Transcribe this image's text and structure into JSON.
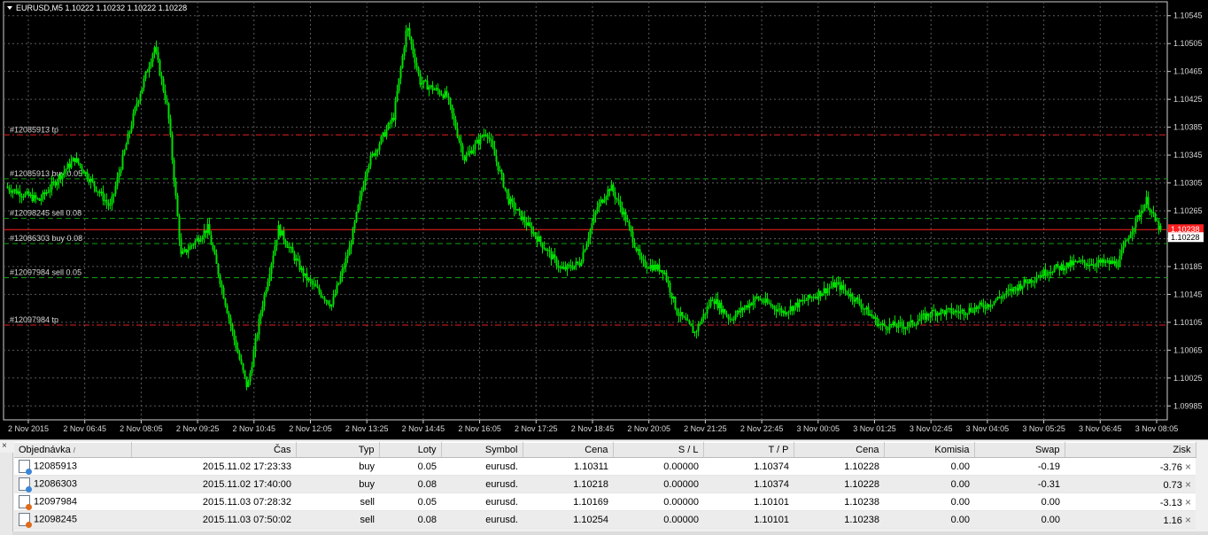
{
  "chart": {
    "header": "EURUSD,M5  1.10222 1.10232 1.10222 1.10228",
    "y_ticks": [
      "1.10545",
      "1.10505",
      "1.10465",
      "1.10425",
      "1.10385",
      "1.10345",
      "1.10305",
      "1.10265",
      "1.10225",
      "1.10185",
      "1.10145",
      "1.10105",
      "1.10065",
      "1.10025",
      "1.09985"
    ],
    "x_ticks": [
      "2 Nov 2015",
      "2 Nov 06:45",
      "2 Nov 08:05",
      "2 Nov 09:25",
      "2 Nov 10:45",
      "2 Nov 12:05",
      "2 Nov 13:25",
      "2 Nov 14:45",
      "2 Nov 16:05",
      "2 Nov 17:25",
      "2 Nov 18:45",
      "2 Nov 20:05",
      "2 Nov 21:25",
      "2 Nov 22:45",
      "3 Nov 00:05",
      "3 Nov 01:25",
      "3 Nov 02:45",
      "3 Nov 04:05",
      "3 Nov 05:25",
      "3 Nov 06:45",
      "3 Nov 08:05"
    ],
    "price_tag_bid": "1.10238",
    "price_tag_current": "1.10228",
    "colors": {
      "background": "#000000",
      "candle": "#00e000",
      "grid": "#5a5a5a",
      "tp": "#e02020",
      "sl": "#10a010",
      "bid": "#ff2020"
    },
    "levels": [
      {
        "label": "#12085913 tp",
        "price": 1.10374,
        "kind": "tp"
      },
      {
        "label": "#12085913 buy 0.05",
        "price": 1.10311,
        "kind": "entry"
      },
      {
        "label": "#12098245 sell 0.08",
        "price": 1.10254,
        "kind": "entry"
      },
      {
        "label": "#12086303 buy 0.08",
        "price": 1.10218,
        "kind": "entry"
      },
      {
        "label": "#12097984 sell 0.05",
        "price": 1.10169,
        "kind": "entry"
      },
      {
        "label": "#12097984 tp",
        "price": 1.10101,
        "kind": "tp"
      }
    ],
    "bid_price": 1.10238
  },
  "terminal": {
    "close_label": "×",
    "columns": [
      "Objednávka",
      "Čas",
      "Typ",
      "Loty",
      "Symbol",
      "Cena",
      "S / L",
      "T / P",
      "Cena",
      "Komisia",
      "Swap",
      "Zisk"
    ],
    "rows": [
      {
        "order": "12085913",
        "time": "2015.11.02 17:23:33",
        "type": "buy",
        "lots": "0.05",
        "symbol": "eurusd.",
        "price": "1.10311",
        "sl": "0.00000",
        "tp": "1.10374",
        "cur": "1.10228",
        "commission": "0.00",
        "swap": "-0.19",
        "profit": "-3.76"
      },
      {
        "order": "12086303",
        "time": "2015.11.02 17:40:00",
        "type": "buy",
        "lots": "0.08",
        "symbol": "eurusd.",
        "price": "1.10218",
        "sl": "0.00000",
        "tp": "1.10374",
        "cur": "1.10228",
        "commission": "0.00",
        "swap": "-0.31",
        "profit": "0.73"
      },
      {
        "order": "12097984",
        "time": "2015.11.03 07:28:32",
        "type": "sell",
        "lots": "0.05",
        "symbol": "eurusd.",
        "price": "1.10169",
        "sl": "0.00000",
        "tp": "1.10101",
        "cur": "1.10238",
        "commission": "0.00",
        "swap": "0.00",
        "profit": "-3.13"
      },
      {
        "order": "12098245",
        "time": "2015.11.03 07:50:02",
        "type": "sell",
        "lots": "0.08",
        "symbol": "eurusd.",
        "price": "1.10254",
        "sl": "0.00000",
        "tp": "1.10101",
        "cur": "1.10238",
        "commission": "0.00",
        "swap": "0.00",
        "profit": "1.16"
      }
    ],
    "close_row_label": "×"
  }
}
